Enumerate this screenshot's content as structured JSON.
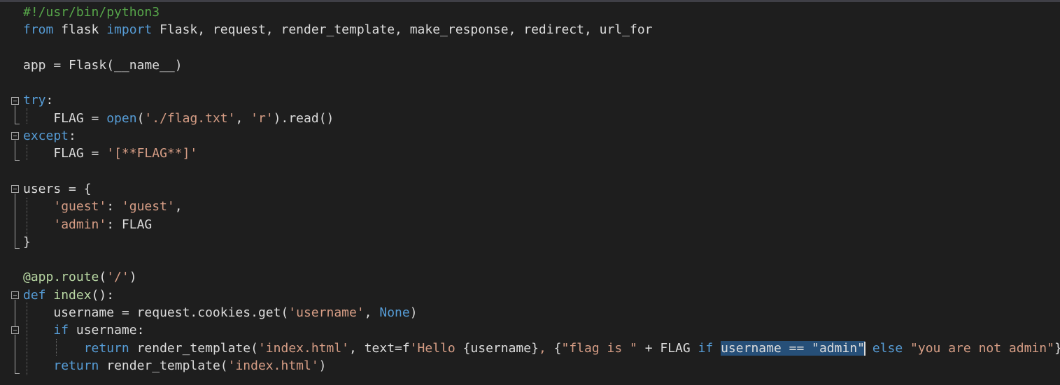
{
  "editor": {
    "lines": [
      [
        {
          "t": "comment",
          "v": "#!/usr/bin/python3"
        }
      ],
      [
        {
          "t": "kw",
          "v": "from"
        },
        {
          "t": "plain",
          "v": " flask "
        },
        {
          "t": "kw",
          "v": "import"
        },
        {
          "t": "plain",
          "v": " Flask, request, render_template, make_response, redirect, url_for"
        }
      ],
      [],
      [
        {
          "t": "plain",
          "v": "app = Flask(__name__)"
        }
      ],
      [],
      [
        {
          "t": "kw",
          "v": "try"
        },
        {
          "t": "plain",
          "v": ":"
        }
      ],
      [
        {
          "t": "plain",
          "v": "    FLAG = "
        },
        {
          "t": "kw",
          "v": "open"
        },
        {
          "t": "plain",
          "v": "("
        },
        {
          "t": "str",
          "v": "'./flag.txt'"
        },
        {
          "t": "plain",
          "v": ", "
        },
        {
          "t": "str",
          "v": "'r'"
        },
        {
          "t": "plain",
          "v": ").read()"
        }
      ],
      [
        {
          "t": "kw",
          "v": "except"
        },
        {
          "t": "plain",
          "v": ":"
        }
      ],
      [
        {
          "t": "plain",
          "v": "    FLAG = "
        },
        {
          "t": "str",
          "v": "'[**FLAG**]'"
        }
      ],
      [],
      [
        {
          "t": "plain",
          "v": "users = {"
        }
      ],
      [
        {
          "t": "plain",
          "v": "    "
        },
        {
          "t": "str",
          "v": "'guest'"
        },
        {
          "t": "plain",
          "v": ": "
        },
        {
          "t": "str",
          "v": "'guest'"
        },
        {
          "t": "plain",
          "v": ","
        }
      ],
      [
        {
          "t": "plain",
          "v": "    "
        },
        {
          "t": "str",
          "v": "'admin'"
        },
        {
          "t": "plain",
          "v": ": FLAG"
        }
      ],
      [
        {
          "t": "plain",
          "v": "}"
        }
      ],
      [],
      [
        {
          "t": "deco",
          "v": "@app.route"
        },
        {
          "t": "plain",
          "v": "("
        },
        {
          "t": "str",
          "v": "'/'"
        },
        {
          "t": "plain",
          "v": ")"
        }
      ],
      [
        {
          "t": "kw",
          "v": "def"
        },
        {
          "t": "plain",
          "v": " "
        },
        {
          "t": "deco",
          "v": "index"
        },
        {
          "t": "plain",
          "v": "():"
        }
      ],
      [
        {
          "t": "plain",
          "v": "    username = request.cookies.get("
        },
        {
          "t": "str",
          "v": "'username'"
        },
        {
          "t": "plain",
          "v": ", "
        },
        {
          "t": "kw",
          "v": "None"
        },
        {
          "t": "plain",
          "v": ")"
        }
      ],
      [
        {
          "t": "plain",
          "v": "    "
        },
        {
          "t": "kw",
          "v": "if"
        },
        {
          "t": "plain",
          "v": " username:"
        }
      ],
      [
        {
          "t": "plain",
          "v": "        "
        },
        {
          "t": "kw",
          "v": "return"
        },
        {
          "t": "plain",
          "v": " render_template("
        },
        {
          "t": "str",
          "v": "'index.html'"
        },
        {
          "t": "plain",
          "v": ", text=f"
        },
        {
          "t": "str",
          "v": "'Hello "
        },
        {
          "t": "plain",
          "v": "{username}"
        },
        {
          "t": "str",
          "v": ", "
        },
        {
          "t": "plain",
          "v": "{"
        },
        {
          "t": "str",
          "v": "\"flag is \""
        },
        {
          "t": "plain",
          "v": " + FLAG "
        },
        {
          "t": "kw",
          "v": "if"
        },
        {
          "t": "plain",
          "v": " "
        },
        {
          "t": "sel",
          "v": "username == \"admin\""
        },
        {
          "t": "caret",
          "v": ""
        },
        {
          "t": "plain",
          "v": " "
        },
        {
          "t": "kw",
          "v": "else"
        },
        {
          "t": "plain",
          "v": " "
        },
        {
          "t": "str",
          "v": "\"you are not admin\""
        },
        {
          "t": "plain",
          "v": "}"
        },
        {
          "t": "str",
          "v": "'"
        },
        {
          "t": "plain",
          "v": ")"
        }
      ],
      [
        {
          "t": "plain",
          "v": "    "
        },
        {
          "t": "kw",
          "v": "return"
        },
        {
          "t": "plain",
          "v": " render_template("
        },
        {
          "t": "str",
          "v": "'index.html'"
        },
        {
          "t": "plain",
          "v": ")"
        }
      ]
    ]
  }
}
